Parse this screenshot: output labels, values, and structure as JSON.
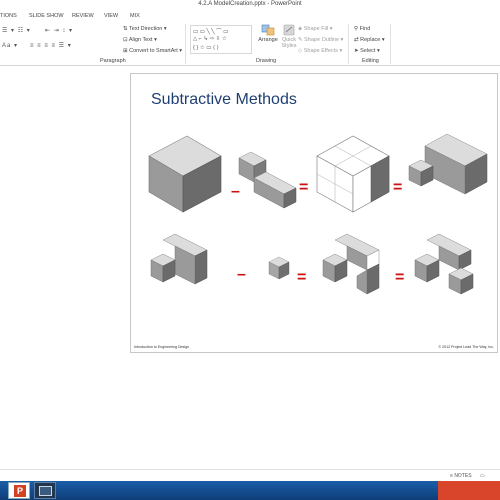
{
  "window": {
    "title": "4.2.A ModelCreation.pptx - PowerPoint"
  },
  "ribbon_tabs": [
    "TIONS",
    "SLIDE SHOW",
    "REVIEW",
    "VIEW",
    "MIX"
  ],
  "ribbon": {
    "paragraph": {
      "label": "Paragraph",
      "text_direction": "Text Direction",
      "align_text": "Align Text",
      "convert_smartart": "Convert to SmartArt",
      "font_case": "Aa"
    },
    "drawing": {
      "label": "Drawing",
      "arrange": "Arrange",
      "quick_styles": "Quick Styles",
      "shape_fill": "Shape Fill",
      "shape_outline": "Shape Outline",
      "shape_effects": "Shape Effects"
    },
    "editing": {
      "label": "Editing",
      "find": "Find",
      "replace": "Replace",
      "select": "Select"
    }
  },
  "slide": {
    "title": "Subtractive Methods",
    "footer_left": "Introduction to Engineering Design",
    "footer_right": "© 2012 Project Lead The Way, Inc.",
    "operators_row1": [
      "–",
      "=",
      "="
    ],
    "operators_row2": [
      "–",
      "=",
      "="
    ]
  },
  "colors": {
    "title": "#1f3f73",
    "operator": "#cc1111",
    "cube_top": "#dcdcdc",
    "cube_left": "#a6a6a6",
    "cube_right": "#6f6f6f",
    "taskbar": "#1b5ea8",
    "tray": "#d9452a"
  },
  "statusbar": {
    "notes": "NOTES"
  }
}
